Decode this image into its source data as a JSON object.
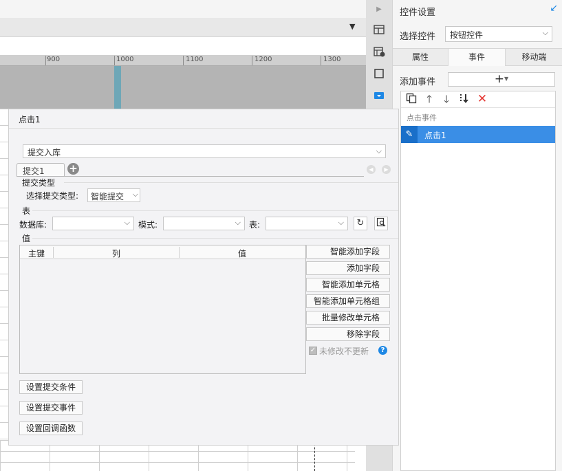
{
  "ruler": {
    "ticks": [
      "900",
      "1000",
      "1100",
      "1200",
      "1300"
    ]
  },
  "right_panel": {
    "title": "控件设置",
    "collapse_icon": "arrow-diagonal-icon",
    "select_label": "选择控件",
    "select_value": "按钮控件",
    "tabs": [
      {
        "label": "属性",
        "active": false
      },
      {
        "label": "事件",
        "active": true
      },
      {
        "label": "移动端",
        "active": false
      }
    ],
    "add_event_label": "添加事件",
    "add_button_glyph": "+",
    "event_group": "点击事件",
    "event_item": "点击1",
    "delete_color": "#e53935"
  },
  "dialog": {
    "title": "点击1",
    "event_type": "提交入库",
    "tab": "提交1",
    "submit_type": {
      "section": "提交类型",
      "label": "选择提交类型:",
      "value": "智能提交"
    },
    "table_section": {
      "section": "表",
      "db_label": "数据库:",
      "schema_label": "模式:",
      "table_label": "表:"
    },
    "value_section": {
      "section": "值",
      "columns": [
        "主键",
        "列",
        "值"
      ]
    },
    "actions": [
      "智能添加字段",
      "添加字段",
      "智能添加单元格",
      "智能添加单元格组",
      "批量修改单元格",
      "移除字段"
    ],
    "checkbox_label": "未修改不更新",
    "checkbox_checked": true,
    "help_glyph": "?",
    "bottom_buttons": [
      "设置提交条件",
      "设置提交事件",
      "设置回调函数"
    ]
  },
  "colors": {
    "accent": "#1e88e5",
    "selected_row": "#3a8ee6"
  }
}
